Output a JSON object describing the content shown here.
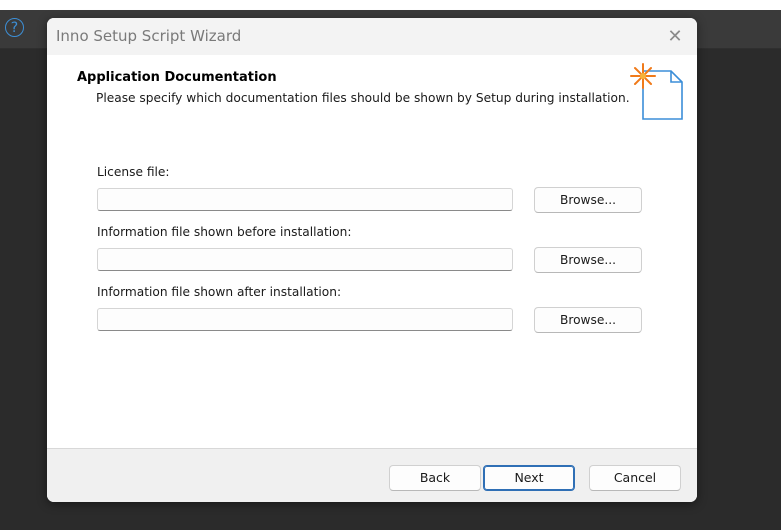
{
  "app": {
    "help_icon": "question-circle-icon",
    "accent_color": "#3d8fd6"
  },
  "dialog": {
    "title": "Inno Setup Script Wizard",
    "close_icon": "close-icon",
    "close_glyph": "✕"
  },
  "page": {
    "heading": "Application Documentation",
    "description": "Please specify which documentation files should be shown by Setup during installation.",
    "icon": "new-document-sparkle-icon"
  },
  "fields": [
    {
      "label": "License file:",
      "value": "",
      "browse_label": "Browse..."
    },
    {
      "label": "Information file shown before installation:",
      "value": "",
      "browse_label": "Browse..."
    },
    {
      "label": "Information file shown after installation:",
      "value": "",
      "browse_label": "Browse..."
    }
  ],
  "footer": {
    "back_label": "Back",
    "next_label": "Next",
    "cancel_label": "Cancel",
    "primary_color": "#2f6fb5"
  }
}
